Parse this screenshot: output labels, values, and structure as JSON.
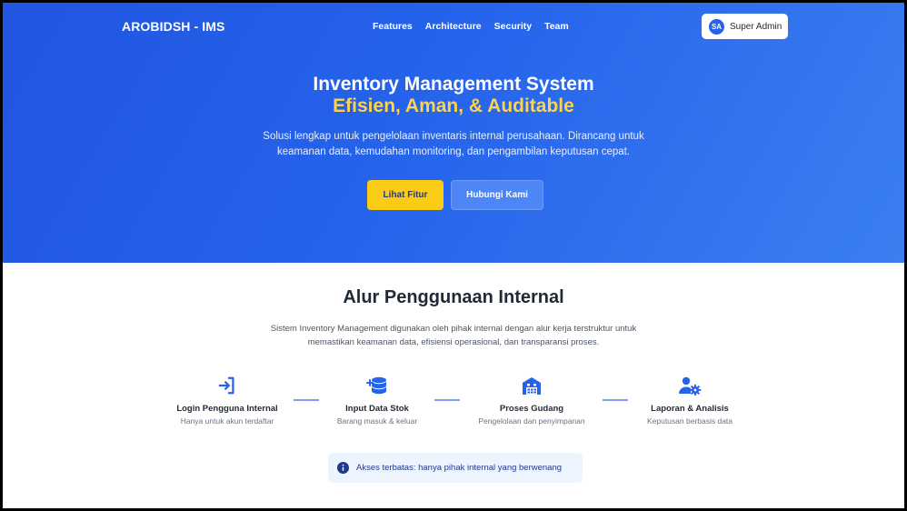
{
  "header": {
    "brand": "AROBIDSH - IMS",
    "nav": [
      "Features",
      "Architecture",
      "Security",
      "Team"
    ],
    "user": {
      "initials": "SA",
      "name": "Super Admin"
    }
  },
  "hero": {
    "title": "Inventory Management System",
    "subtitle": "Efisien, Aman, & Auditable",
    "description": "Solusi lengkap untuk pengelolaan inventaris internal perusahaan. Dirancang untuk keamanan data, kemudahan monitoring, dan pengambilan keputusan cepat.",
    "primary_button": "Lihat Fitur",
    "secondary_button": "Hubungi Kami"
  },
  "flow": {
    "title": "Alur Penggunaan Internal",
    "description": "Sistem Inventory Management digunakan oleh pihak internal dengan alur kerja terstruktur untuk memastikan keamanan data, efisiensi operasional, dan transparansi proses.",
    "steps": [
      {
        "icon": "login-icon",
        "label": "Login Pengguna Internal",
        "caption": "Hanya untuk akun terdaftar"
      },
      {
        "icon": "database-plus-icon",
        "label": "Input Data Stok",
        "caption": "Barang masuk & keluar"
      },
      {
        "icon": "warehouse-icon",
        "label": "Proses Gudang",
        "caption": "Pengelolaan dan penyimpanan"
      },
      {
        "icon": "user-gear-icon",
        "label": "Laporan & Analisis",
        "caption": "Keputusan berbasis data"
      }
    ],
    "notice": "Akses terbatas: hanya pihak internal yang berwenang"
  },
  "colors": {
    "hero_blue": "#2563eb",
    "accent_yellow": "#facc15",
    "subtitle_yellow": "#fcd34d",
    "icon_blue": "#2563eb"
  }
}
